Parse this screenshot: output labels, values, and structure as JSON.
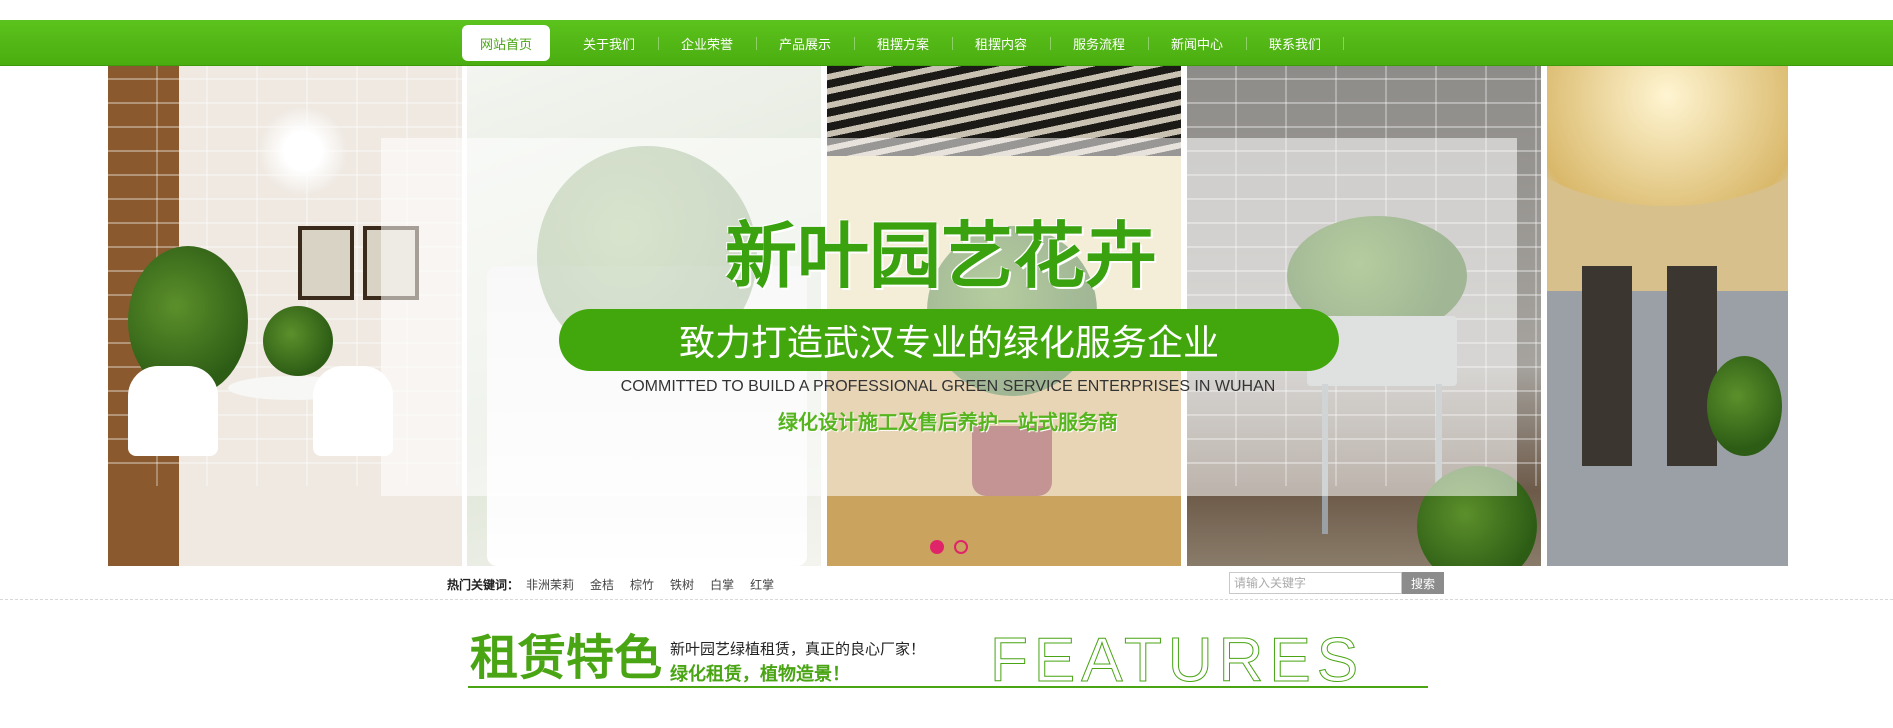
{
  "nav": {
    "items": [
      {
        "label": "网站首页",
        "active": true
      },
      {
        "label": "关于我们"
      },
      {
        "label": "企业荣誉"
      },
      {
        "label": "产品展示"
      },
      {
        "label": "租摆方案"
      },
      {
        "label": "租摆内容"
      },
      {
        "label": "服务流程"
      },
      {
        "label": "新闻中心"
      },
      {
        "label": "联系我们"
      }
    ]
  },
  "banner": {
    "title": "新叶园艺花卉",
    "slogan": "致力打造武汉专业的绿化服务企业",
    "english": "COMMITTED TO BUILD A PROFESSIONAL GREEN SERVICE ENTERPRISES IN WUHAN",
    "subtitle": "绿化设计施工及售后养护一站式服务商",
    "slide_count": 2,
    "active_slide": 1
  },
  "keywords": {
    "label": "热门关键词：",
    "items": [
      "非洲茉莉",
      "金桔",
      "棕竹",
      "铁树",
      "白掌",
      "红掌"
    ]
  },
  "search": {
    "placeholder": "请输入关键字",
    "button": "搜索"
  },
  "features": {
    "title": "租赁特色",
    "line1": "新叶园艺绿植租赁，真正的良心厂家！",
    "line2": "绿化租赁，植物造景！",
    "english": "FEATURES"
  },
  "colors": {
    "brand_green": "#4aa514",
    "slider_dot": "#e0246a"
  }
}
